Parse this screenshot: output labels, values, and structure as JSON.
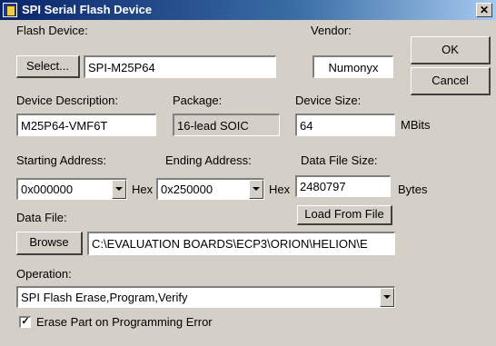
{
  "window": {
    "title": "SPI Serial Flash Device",
    "close_glyph": "✕"
  },
  "flash_device": {
    "label": "Flash Device:",
    "select_label": "Select...",
    "value": "SPI-M25P64"
  },
  "vendor": {
    "label": "Vendor:",
    "value": "Numonyx"
  },
  "buttons": {
    "ok": "OK",
    "cancel": "Cancel",
    "browse": "Browse",
    "load_from_file": "Load From File"
  },
  "device_description": {
    "label": "Device Description:",
    "value": "M25P64-VMF6T"
  },
  "package": {
    "label": "Package:",
    "value": "16-lead SOIC"
  },
  "device_size": {
    "label": "Device Size:",
    "value": "64",
    "unit": "MBits"
  },
  "starting_address": {
    "label": "Starting Address:",
    "value": "0x000000",
    "suffix": "Hex"
  },
  "ending_address": {
    "label": "Ending Address:",
    "value": "0x250000",
    "suffix": "Hex"
  },
  "data_file_size": {
    "label": "Data File Size:",
    "value": "2480797",
    "unit": "Bytes"
  },
  "data_file": {
    "label": "Data File:",
    "value": "C:\\EVALUATION BOARDS\\ECP3\\ORION\\HELION\\E"
  },
  "operation": {
    "label": "Operation:",
    "value": "SPI Flash Erase,Program,Verify"
  },
  "erase_on_error": {
    "checked": true,
    "check_glyph": "✓",
    "label": "Erase Part on Programming Error"
  },
  "icons": {
    "app": "flash-device-icon",
    "dropdown": "chevron-down-icon"
  }
}
